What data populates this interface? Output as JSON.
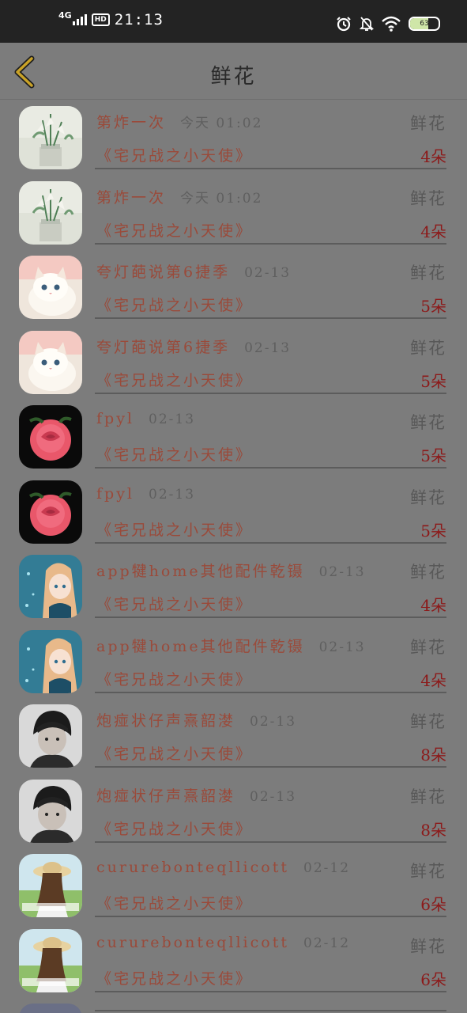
{
  "status_bar": {
    "network": "4G",
    "hd": "HD",
    "time": "21:13",
    "battery": "63",
    "icons": [
      "alarm-icon",
      "bell-off-icon",
      "wifi-icon",
      "battery-icon"
    ]
  },
  "header": {
    "title": "鲜花",
    "back_icon": "chevron-left-icon"
  },
  "colors": {
    "accent_back": "#c9a227",
    "sender_text": "#9a4a3a",
    "count_text": "#8c1a1a"
  },
  "records": [
    {
      "sender": "第炸一次",
      "time": "今天 01:02",
      "room": "《宅兄战之小天使》",
      "gift": "鲜花",
      "count": "4朵",
      "avatar": "flowers-vase-avatar"
    },
    {
      "sender": "第炸一次",
      "time": "今天 01:02",
      "room": "《宅兄战之小天使》",
      "gift": "鲜花",
      "count": "4朵",
      "avatar": "flowers-vase-avatar"
    },
    {
      "sender": "夸灯葩说第6捷季",
      "time": "02-13",
      "room": "《宅兄战之小天使》",
      "gift": "鲜花",
      "count": "5朵",
      "avatar": "kitten-avatar"
    },
    {
      "sender": "夸灯葩说第6捷季",
      "time": "02-13",
      "room": "《宅兄战之小天使》",
      "gift": "鲜花",
      "count": "5朵",
      "avatar": "kitten-avatar"
    },
    {
      "sender": "fpyl",
      "time": "02-13",
      "room": "《宅兄战之小天使》",
      "gift": "鲜花",
      "count": "5朵",
      "avatar": "rose-avatar"
    },
    {
      "sender": "fpyl",
      "time": "02-13",
      "room": "《宅兄战之小天使》",
      "gift": "鲜花",
      "count": "5朵",
      "avatar": "rose-avatar"
    },
    {
      "sender": "app犍home其他配件乾镊",
      "time": "02-13",
      "room": "《宅兄战之小天使》",
      "gift": "鲜花",
      "count": "4朵",
      "avatar": "anime-girl-avatar"
    },
    {
      "sender": "app犍home其他配件乾镊",
      "time": "02-13",
      "room": "《宅兄战之小天使》",
      "gift": "鲜花",
      "count": "4朵",
      "avatar": "anime-girl-avatar"
    },
    {
      "sender": "炮痖状仔声熹韶漤",
      "time": "02-13",
      "room": "《宅兄战之小天使》",
      "gift": "鲜花",
      "count": "8朵",
      "avatar": "boy-portrait-avatar"
    },
    {
      "sender": "炮痖状仔声熹韶漤",
      "time": "02-13",
      "room": "《宅兄战之小天使》",
      "gift": "鲜花",
      "count": "8朵",
      "avatar": "boy-portrait-avatar"
    },
    {
      "sender": "cururebonteqllicott",
      "time": "02-12",
      "room": "《宅兄战之小天使》",
      "gift": "鲜花",
      "count": "6朵",
      "avatar": "girl-hat-avatar"
    },
    {
      "sender": "cururebonteqllicott",
      "time": "02-12",
      "room": "《宅兄战之小天使》",
      "gift": "鲜花",
      "count": "6朵",
      "avatar": "girl-hat-avatar"
    }
  ]
}
